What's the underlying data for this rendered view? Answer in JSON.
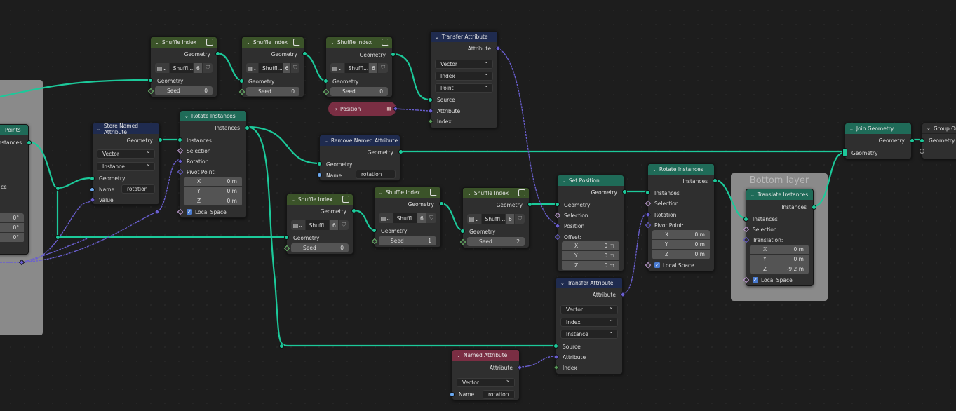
{
  "frames": {
    "left_partial": {
      "label": ""
    },
    "bottom_layer": {
      "label": "Bottom layer"
    }
  },
  "socket_colors": {
    "geometry": "#1cc99a",
    "vector": "#6a5fd0",
    "string": "#6aa8f0",
    "boolean": "#c5a0d8",
    "integer": "#5a9a5a"
  },
  "header_colors": {
    "geometry_op": "#3b5329",
    "instance_op": "#1f6b58",
    "attribute_op": "#1f2b4f",
    "input": "#7a2e43"
  },
  "nodes": {
    "points_partial": {
      "title": "Points",
      "out": "Instances",
      "partial_label": "ce",
      "rot": [
        "0°",
        "0°",
        "0°"
      ]
    },
    "shuffle1": {
      "title": "Shuffle Index",
      "out": "Geometry",
      "in": "Geometry",
      "mode": "Shuffl...",
      "count": "6",
      "seed_label": "Seed",
      "seed": "0"
    },
    "shuffle2": {
      "title": "Shuffle Index",
      "out": "Geometry",
      "in": "Geometry",
      "mode": "Shuffl...",
      "count": "6",
      "seed_label": "Seed",
      "seed": "0"
    },
    "shuffle3": {
      "title": "Shuffle Index",
      "out": "Geometry",
      "in": "Geometry",
      "mode": "Shuffl...",
      "count": "6",
      "seed_label": "Seed",
      "seed": "0"
    },
    "shuffle4": {
      "title": "Shuffle Index",
      "out": "Geometry",
      "in": "Geometry",
      "mode": "Shuffl...",
      "count": "6",
      "seed_label": "Seed",
      "seed": "0"
    },
    "shuffle5": {
      "title": "Shuffle Index",
      "out": "Geometry",
      "in": "Geometry",
      "mode": "Shuffl...",
      "count": "6",
      "seed_label": "Seed",
      "seed": "1"
    },
    "shuffle6": {
      "title": "Shuffle Index",
      "out": "Geometry",
      "in": "Geometry",
      "mode": "Shuffl...",
      "count": "6",
      "seed_label": "Seed",
      "seed": "2"
    },
    "transfer1": {
      "title": "Transfer Attribute",
      "out": "Attribute",
      "type": "Vector",
      "mode": "Index",
      "domain": "Point",
      "source": "Source",
      "attribute": "Attribute",
      "index": "Index"
    },
    "transfer2": {
      "title": "Transfer Attribute",
      "out": "Attribute",
      "type": "Vector",
      "mode": "Index",
      "domain": "Instance",
      "source": "Source",
      "attribute": "Attribute",
      "index": "Index"
    },
    "position": {
      "title": "Position"
    },
    "store_named": {
      "title": "Store Named Attribute",
      "out": "Geometry",
      "type": "Vector",
      "domain": "Instance",
      "in": "Geometry",
      "name_label": "Name",
      "name": "rotation",
      "value": "Value"
    },
    "rotate1": {
      "title": "Rotate Instances",
      "out": "Instances",
      "in": "Instances",
      "selection": "Selection",
      "rotation": "Rotation",
      "pivot": "Pivot Point:",
      "x": "0 m",
      "y": "0 m",
      "z": "0 m",
      "local": "Local Space"
    },
    "rotate2": {
      "title": "Rotate Instances",
      "out": "Instances",
      "in": "Instances",
      "selection": "Selection",
      "rotation": "Rotation",
      "pivot": "Pivot Point:",
      "x": "0 m",
      "y": "0 m",
      "z": "0 m",
      "local": "Local Space"
    },
    "remove_named": {
      "title": "Remove Named Attribute",
      "out": "Geometry",
      "in": "Geometry",
      "name_label": "Name",
      "name": "rotation"
    },
    "set_position": {
      "title": "Set Position",
      "out": "Geometry",
      "in": "Geometry",
      "selection": "Selection",
      "position": "Position",
      "offset": "Offset:",
      "x": "0 m",
      "y": "0 m",
      "z": "0 m"
    },
    "translate": {
      "title": "Translate Instances",
      "out": "Instances",
      "in": "Instances",
      "selection": "Selection",
      "translation": "Translation:",
      "x": "0 m",
      "y": "0 m",
      "z": "-9.2 m",
      "local": "Local Space"
    },
    "join": {
      "title": "Join Geometry",
      "out": "Geometry",
      "in": "Geometry"
    },
    "group_output": {
      "title": "Group Ou",
      "in": "Geometry"
    },
    "named_attr": {
      "title": "Named Attribute",
      "out": "Attribute",
      "type": "Vector",
      "name_label": "Name",
      "name": "rotation"
    }
  },
  "axis": {
    "x": "X",
    "y": "Y",
    "z": "Z"
  }
}
